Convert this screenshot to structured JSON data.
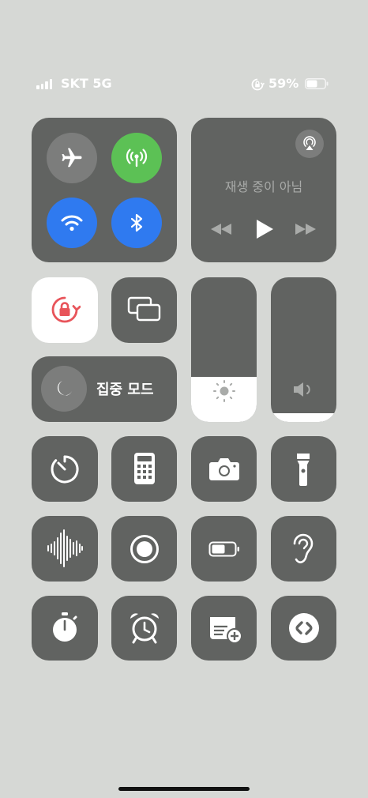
{
  "status_bar": {
    "carrier": "SKT 5G",
    "battery_percent": "59%",
    "battery_level": 0.59
  },
  "connectivity": {
    "airplane": {
      "icon": "airplane-icon",
      "active": false,
      "color": "#7c7d7c"
    },
    "cellular": {
      "icon": "cellular-antenna-icon",
      "active": true,
      "color": "#5cc155"
    },
    "wifi": {
      "icon": "wifi-icon",
      "active": true,
      "color": "#2f7af0"
    },
    "bluetooth": {
      "icon": "bluetooth-icon",
      "active": true,
      "color": "#2f7af0"
    }
  },
  "media": {
    "status": "재생 중이 아님",
    "airplay_icon": "airplay-icon"
  },
  "focus": {
    "label": "집중 모드",
    "icon": "moon-icon"
  },
  "sliders": {
    "brightness": {
      "level": 0.31,
      "icon": "sun-icon"
    },
    "volume": {
      "level": 0.06,
      "icon": "speaker-icon"
    }
  },
  "colors": {
    "tile": "#616361",
    "background": "#d6d8d5",
    "rotation_lock_red": "#e8545a"
  },
  "controls": [
    "timer-icon",
    "calculator-icon",
    "camera-icon",
    "flashlight-icon",
    "sound-recognition-icon",
    "screen-record-icon",
    "low-power-battery-icon",
    "hearing-icon",
    "stopwatch-icon",
    "alarm-icon",
    "quick-note-icon",
    "shazam-icon"
  ]
}
